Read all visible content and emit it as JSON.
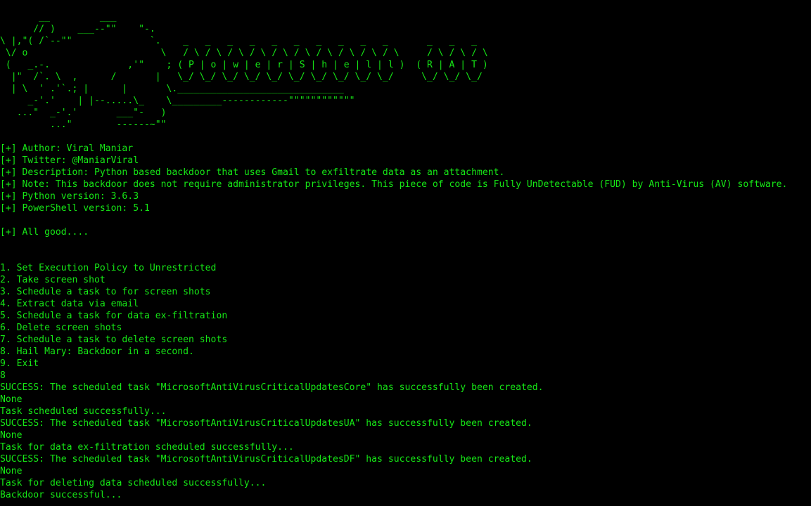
{
  "terminal": {
    "banner": [
      "       __         ___",
      "      // )    ___--\"\"    \"-.",
      "\\ |,\"( /`--\"\"              `.    _   _   _   _   _   _   _   _   _   _       _   _   _",
      " \\/ o                        \\   / \\ / \\ / \\ / \\ / \\ / \\ / \\ / \\ / \\ / \\     / \\ / \\ / \\",
      " (   _.-.              ,'\"    ; ( P | o | w | e | r | S | h | e | l | l )  ( R | A | T )",
      "  |\"  /`. \\  ,      /       |   \\_/ \\_/ \\_/ \\_/ \\_/ \\_/ \\_/ \\_/ \\_/ \\_/     \\_/ \\_/ \\_/",
      "  | \\  ' .'`.; |      |       \\.______________________________",
      "     _-'.'    | |--.....\\_    \\_________------------\"\"\"\"\"\"\"\"\"\"\"\"",
      "   ...\"  _-'.'       ___\"-   )",
      "         ...\"        ------~\"\""
    ],
    "info": [
      "[+] Author: Viral Maniar",
      "[+] Twitter: @ManiarViral",
      "[+] Description: Python based backdoor that uses Gmail to exfiltrate data as an attachment.",
      "[+] Note: This backdoor does not require administrator privileges. This piece of code is Fully UnDetectable (FUD) by Anti-Virus (AV) software.",
      "[+] Python version: 3.6.3",
      "[+] PowerShell version: 5.1"
    ],
    "status": "[+] All good....",
    "menu": [
      "1. Set Execution Policy to Unrestricted",
      "2. Take screen shot",
      "3. Schedule a task to for screen shots",
      "4. Extract data via email",
      "5. Schedule a task for data ex-filtration",
      "6. Delete screen shots",
      "7. Schedule a task to delete screen shots",
      "8. Hail Mary: Backdoor in a second.",
      "9. Exit"
    ],
    "user_input": "8",
    "output": [
      "SUCCESS: The scheduled task \"MicrosoftAntiVirusCriticalUpdatesCore\" has successfully been created.",
      "None",
      "Task scheduled successfully...",
      "SUCCESS: The scheduled task \"MicrosoftAntiVirusCriticalUpdatesUA\" has successfully been created.",
      "None",
      "Task for data ex-filtration scheduled successfully...",
      "SUCCESS: The scheduled task \"MicrosoftAntiVirusCriticalUpdatesDF\" has successfully been created.",
      "None",
      "Task for deleting data scheduled successfully...",
      "Backdoor successful..."
    ],
    "colors": {
      "background": "#000000",
      "text": "#16e716"
    }
  }
}
